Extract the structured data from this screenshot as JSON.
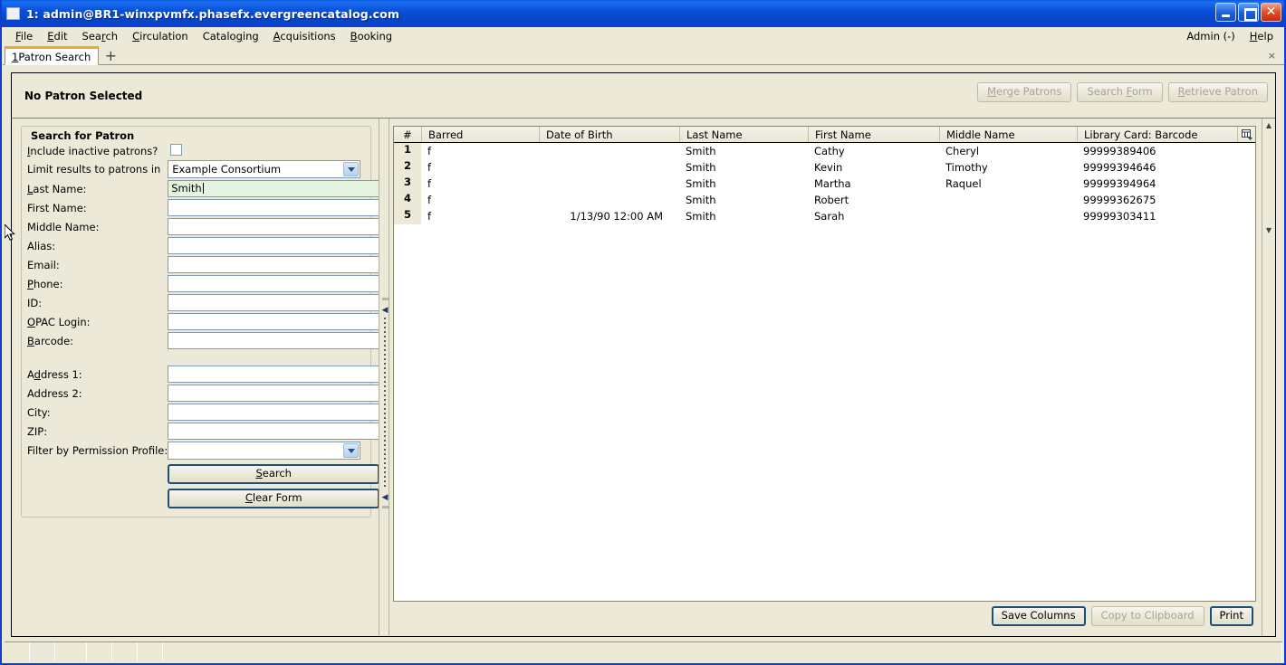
{
  "window": {
    "title": "1: admin@BR1-winxpvmfx.phasefx.evergreencatalog.com",
    "minimize_label": "_",
    "maximize_label": "",
    "close_label": "✕"
  },
  "menubar": {
    "items": [
      {
        "label": "File",
        "accel": "F"
      },
      {
        "label": "Edit",
        "accel": "E"
      },
      {
        "label": "Search",
        "accel": "r"
      },
      {
        "label": "Circulation",
        "accel": "C"
      },
      {
        "label": "Cataloging",
        "accel": "g"
      },
      {
        "label": "Acquisitions",
        "accel": "A"
      },
      {
        "label": "Booking",
        "accel": "B"
      }
    ],
    "admin_label": "Admin (-)",
    "help_label": "Help"
  },
  "tabs": {
    "active": "1 Patron Search",
    "active_number": "1",
    "active_name": " Patron Search",
    "new_tab_label": "+",
    "close_label": "×"
  },
  "patron_bar": {
    "title": "No Patron Selected",
    "buttons": [
      {
        "label": "Merge Patrons",
        "enabled": false
      },
      {
        "label": "Search Form",
        "enabled": false
      },
      {
        "label": "Retrieve Patron",
        "enabled": false
      }
    ]
  },
  "search_form": {
    "legend": "Search for Patron",
    "include_inactive_label": "Include inactive patrons?",
    "include_inactive_checked": false,
    "limit_results_label": "Limit results to patrons in",
    "limit_results_value": "Example Consortium",
    "fields": [
      {
        "label": "Last Name:",
        "value": "Smith",
        "filled": true
      },
      {
        "label": "First Name:",
        "value": "",
        "filled": false
      },
      {
        "label": "Middle Name:",
        "value": "",
        "filled": false
      },
      {
        "label": "Alias:",
        "value": "",
        "filled": false
      },
      {
        "label": "Email:",
        "value": "",
        "filled": false
      },
      {
        "label": "Phone:",
        "value": "",
        "filled": false
      },
      {
        "label": "ID:",
        "value": "",
        "filled": false
      },
      {
        "label": "OPAC Login:",
        "value": "",
        "filled": false
      },
      {
        "label": "Barcode:",
        "value": "",
        "filled": false
      }
    ],
    "address_fields": [
      {
        "label": "Address 1:",
        "value": ""
      },
      {
        "label": "Address 2:",
        "value": ""
      },
      {
        "label": "City:",
        "value": ""
      },
      {
        "label": "ZIP:",
        "value": ""
      }
    ],
    "permission_profile_label": "Filter by Permission Profile:",
    "permission_profile_value": "",
    "search_button": "Search",
    "clear_button": "Clear Form"
  },
  "results": {
    "columns": [
      "#",
      "Barred",
      "Date of Birth",
      "Last Name",
      "First Name",
      "Middle Name",
      "Library Card: Barcode"
    ],
    "column_picker_icon": "columns-icon",
    "rows": [
      {
        "num": "1",
        "barred": "f",
        "dob": "",
        "last": "Smith",
        "first": "Cathy",
        "middle": "Cheryl",
        "barcode": "99999389406"
      },
      {
        "num": "2",
        "barred": "f",
        "dob": "",
        "last": "Smith",
        "first": "Kevin",
        "middle": "Timothy",
        "barcode": "99999394646"
      },
      {
        "num": "3",
        "barred": "f",
        "dob": "",
        "last": "Smith",
        "first": "Martha",
        "middle": "Raquel",
        "barcode": "99999394964"
      },
      {
        "num": "4",
        "barred": "f",
        "dob": "",
        "last": "Smith",
        "first": "Robert",
        "middle": "",
        "barcode": "99999362675"
      },
      {
        "num": "5",
        "barred": "f",
        "dob": "1/13/90 12:00 AM",
        "last": "Smith",
        "first": "Sarah",
        "middle": "",
        "barcode": "99999303411"
      }
    ],
    "footer_buttons": [
      {
        "label": "Save Columns",
        "enabled": true
      },
      {
        "label": "Copy to Clipboard",
        "enabled": false
      },
      {
        "label": "Print",
        "enabled": true
      }
    ]
  },
  "statusbar": {
    "cells": [
      "",
      "",
      "",
      "",
      "",
      "",
      ""
    ]
  },
  "colors": {
    "chrome": "#ece9d8",
    "titlebar": "#0b4fd8",
    "tab_accent": "#f0a732",
    "field_filled": "#e3f5e0",
    "default_button_border": "#1f4e79"
  }
}
